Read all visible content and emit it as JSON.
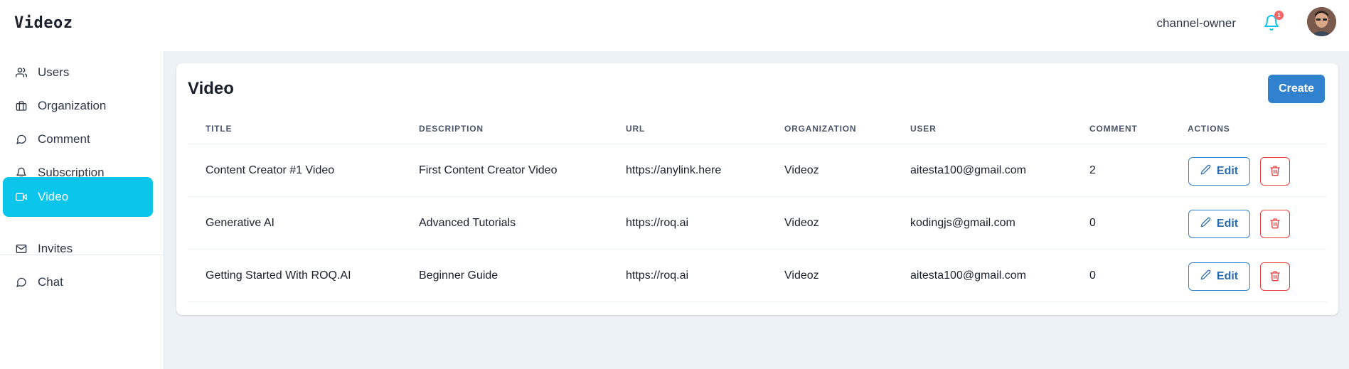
{
  "app": {
    "brand": "Videoz"
  },
  "header": {
    "role": "channel-owner",
    "notification_count": "1"
  },
  "sidebar": {
    "items": [
      {
        "label": "Users",
        "icon": "users-icon"
      },
      {
        "label": "Organization",
        "icon": "briefcase-icon"
      },
      {
        "label": "Comment",
        "icon": "chat-bubble-icon"
      },
      {
        "label": "Subscription",
        "icon": "bell-icon"
      },
      {
        "label": "Video",
        "icon": "video-camera-icon",
        "active": true
      },
      {
        "label": "Invites",
        "icon": "mail-icon"
      },
      {
        "label": "Chat",
        "icon": "chat-bubble-icon"
      }
    ]
  },
  "page": {
    "title": "Video",
    "create_label": "Create"
  },
  "table": {
    "columns": [
      "TITLE",
      "DESCRIPTION",
      "URL",
      "ORGANIZATION",
      "USER",
      "COMMENT",
      "ACTIONS"
    ],
    "rows": [
      {
        "title": "Content Creator #1 Video",
        "description": "First Content Creator Video",
        "url": "https://anylink.here",
        "organization": "Videoz",
        "user": "aitesta100@gmail.com",
        "comment": "2"
      },
      {
        "title": "Generative AI",
        "description": "Advanced Tutorials",
        "url": "https://roq.ai",
        "organization": "Videoz",
        "user": "kodingjs@gmail.com",
        "comment": "0"
      },
      {
        "title": "Getting Started With ROQ.AI",
        "description": "Beginner Guide",
        "url": "https://roq.ai",
        "organization": "Videoz",
        "user": "aitesta100@gmail.com",
        "comment": "0"
      }
    ],
    "edit_label": "Edit"
  },
  "colors": {
    "accent": "#0bc5ea",
    "primary": "#3182ce",
    "danger": "#e53e3e",
    "background": "#edf2f7"
  }
}
